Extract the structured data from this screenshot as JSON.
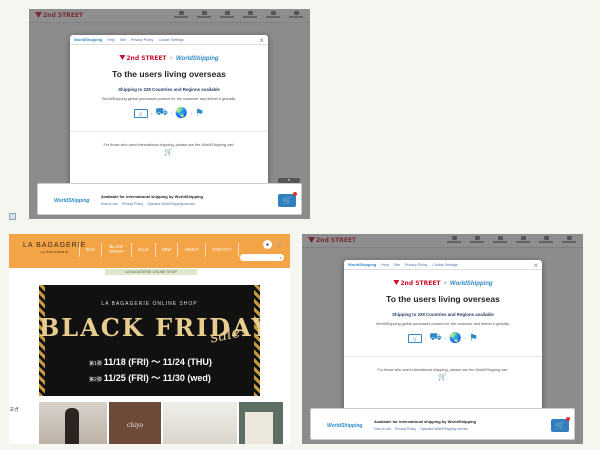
{
  "modal": {
    "top_links": [
      "Help",
      "Site",
      "Privacy Policy",
      "Cookie Settings"
    ],
    "top_brand": "WorldShipping",
    "close": "×",
    "logo_2nd": "2nd STREET",
    "logo_x": "×",
    "logo_ws": "WorldShipping",
    "heading": "To the users living overseas",
    "subheading": "Shipping to 228 Countries and Regions available",
    "description": "WorldShipping global purchases product for the customer and deliver it globally.",
    "note": "For those who want international shipping, please use the WorldShipping cart."
  },
  "bottom_bar": {
    "title": "Available for international shipping by WorldShipping",
    "brand": "WorldShipping",
    "links": [
      "How to use",
      "Privacy Policy",
      "Operator WorldShipping service"
    ]
  },
  "lb": {
    "logo": "LA BAGAGERIE",
    "logo_sub": "LA BAGAGERIE",
    "nav": [
      "BAG",
      "BLACK FRIDAY",
      "SALE",
      "NEW",
      "ABOUT",
      "CONTACT"
    ],
    "banner_title": "LA BAGAGERIE ONLINE SHOP",
    "promo": {
      "top": "LA BAGAGERIE ONLINE SHOP",
      "headline": "BLACK FRIDAY",
      "sale": "sale!",
      "phase1_label": "第1弾",
      "phase1": "11/18 (FRI) 〜 11/24 (THU)",
      "phase2_label": "第2弾",
      "phase2": "11/25 (FRI) 〜 11/30 (wed)"
    },
    "photo_label": "chiyo",
    "jp_label": "ヨガ"
  },
  "colors": {
    "brand_red": "#c8102e",
    "ws_blue": "#2f8ac7",
    "lb_orange": "#f3a446",
    "promo_gold": "#e8cd8f"
  }
}
